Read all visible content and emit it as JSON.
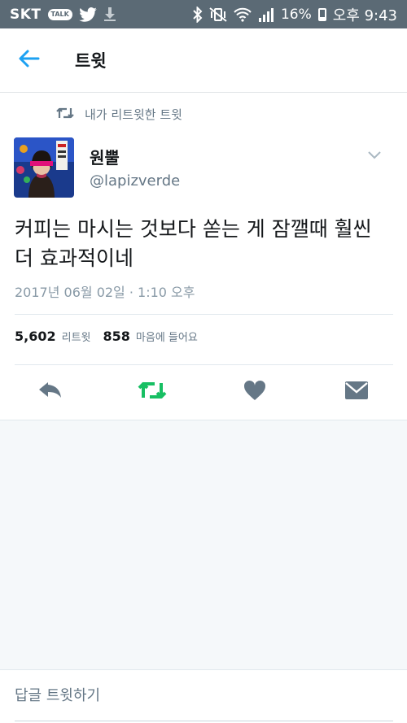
{
  "statusbar": {
    "carrier": "SKT",
    "talk": "TALK",
    "battery": "16%",
    "time": "오후 9:43"
  },
  "header": {
    "title": "트윗"
  },
  "tweet": {
    "retweet_context": "내가 리트윗한 트윗",
    "author_name": "원뿔",
    "author_handle": "@lapizverde",
    "text": "커피는 마시는 것보다 쏟는 게 잠깰때 훨씬 더 효과적이네",
    "timestamp": "2017년 06월 02일 · 1:10 오후",
    "retweet_count": "5,602",
    "retweet_label": "리트윗",
    "like_count": "858",
    "like_label": "마음에 들어요"
  },
  "reply": {
    "placeholder": "답글 트윗하기"
  },
  "colors": {
    "accent": "#1da1f2",
    "retweet_green": "#17bf63",
    "icon_gray": "#657786",
    "statusbar": "#5b6a75"
  }
}
